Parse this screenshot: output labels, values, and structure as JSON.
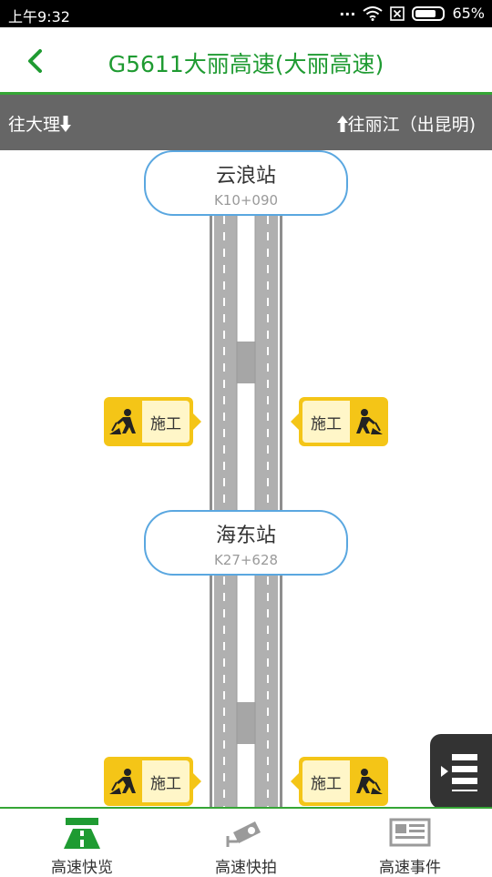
{
  "status_bar": {
    "time": "上午9:32",
    "battery": "65%"
  },
  "header": {
    "title": "G5611大丽高速(大丽高速)"
  },
  "direction_bar": {
    "left": "往大理",
    "right": "往丽江（出昆明)"
  },
  "stations": [
    {
      "name": "云浪站",
      "km": "K10+090"
    },
    {
      "name": "海东站",
      "km": "K27+628"
    }
  ],
  "events": {
    "label": "施工"
  },
  "bottom_nav": [
    {
      "label": "高速快览",
      "icon": "highway-icon",
      "active": true
    },
    {
      "label": "高速快拍",
      "icon": "camera-icon",
      "active": false
    },
    {
      "label": "高速事件",
      "icon": "newspaper-icon",
      "active": false
    }
  ],
  "colors": {
    "brand_green": "#1f9b32",
    "station_border": "#5aa7e0",
    "event_yellow": "#f4c517",
    "direction_bar": "#666666"
  }
}
